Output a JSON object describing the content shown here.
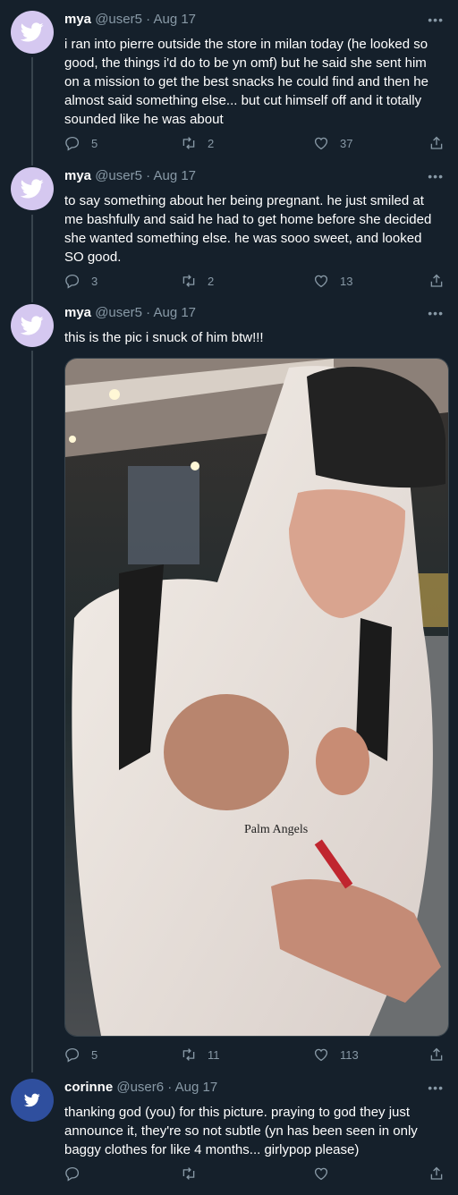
{
  "tweets": [
    {
      "name": "mya",
      "handle": "@user5",
      "separator": "·",
      "date": "Aug 17",
      "text": "i ran into pierre outside the store in milan today (he looked so good, the things i'd do to be yn omf) but he said she sent him on a mission to get the best snacks he could find and then he almost said something else... but cut himself off and it totally sounded like he was about",
      "replies": "5",
      "retweets": "2",
      "likes": "37"
    },
    {
      "name": "mya",
      "handle": "@user5",
      "separator": "·",
      "date": "Aug 17",
      "text": "to say something about her being pregnant. he just smiled at me bashfully and said he had to get home before she decided she wanted something else. he was sooo sweet, and looked SO good.",
      "replies": "3",
      "retweets": "2",
      "likes": "13"
    },
    {
      "name": "mya",
      "handle": "@user5",
      "separator": "·",
      "date": "Aug 17",
      "text": "this is the pic i snuck of him btw!!!",
      "replies": "5",
      "retweets": "11",
      "likes": "113",
      "photo_text": "Palm Angels"
    },
    {
      "name": "corinne",
      "handle": "@user6",
      "separator": "·",
      "date": "Aug 17",
      "text": "thanking god (you) for this picture. praying to god they just announce it, they're so not subtle (yn has been seen in only baggy clothes for like 4 months... girlypop please)",
      "replies": "",
      "retweets": "",
      "likes": ""
    }
  ],
  "colors": {
    "background": "#15202b",
    "secondary_text": "#8899a6",
    "avatar_user5": "#d5c8f0",
    "avatar_user6": "#2f4f9e",
    "divider": "#38444d"
  },
  "icons": [
    "twitter-bird-icon",
    "more-icon",
    "reply-icon",
    "retweet-icon",
    "like-icon",
    "share-icon"
  ]
}
